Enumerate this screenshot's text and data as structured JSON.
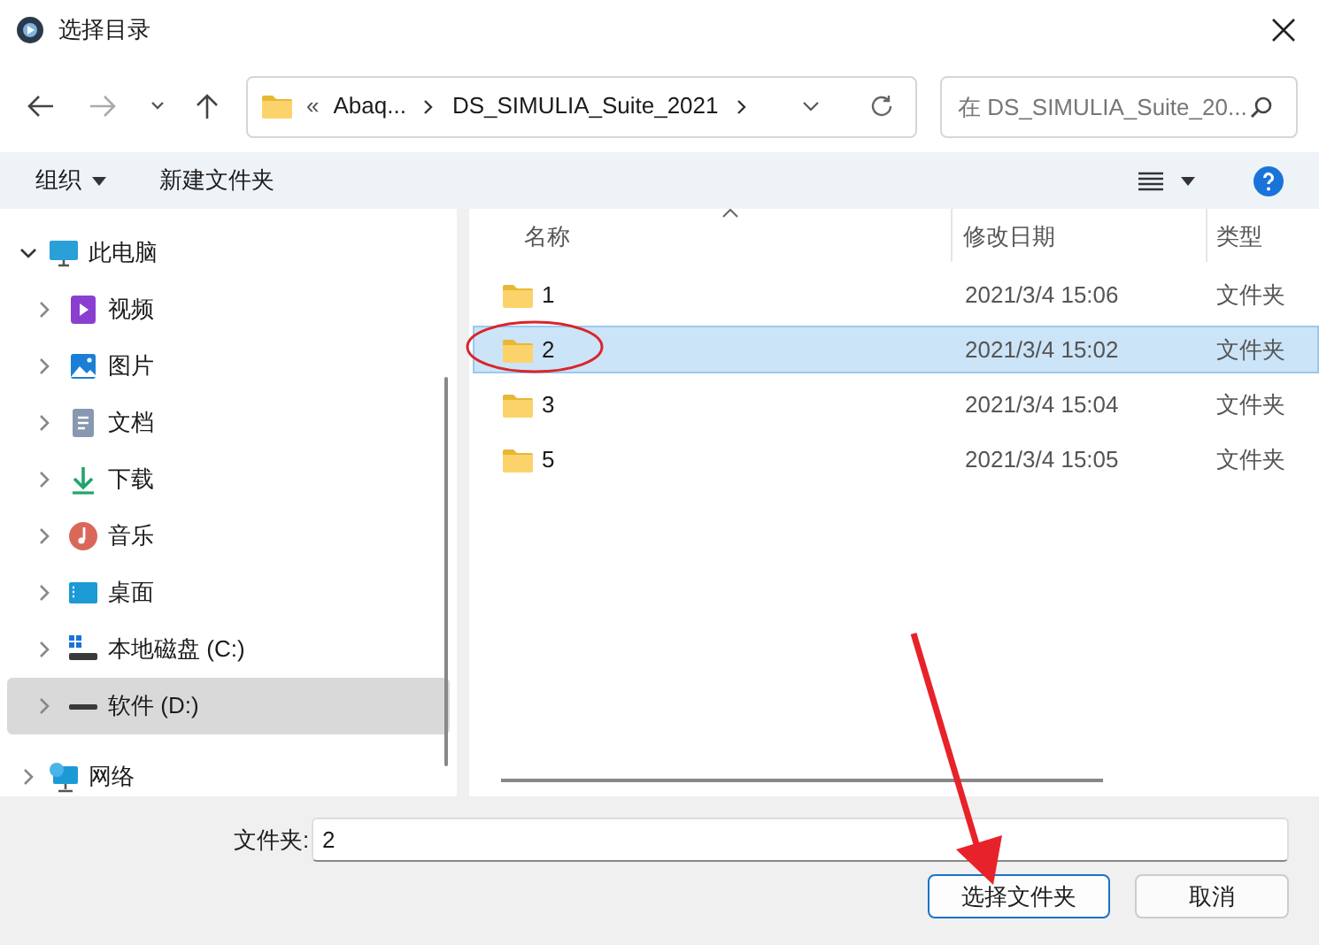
{
  "window": {
    "title": "选择目录"
  },
  "nav": {
    "overflow": "«",
    "address": [
      "Abaq...",
      "DS_SIMULIA_Suite_2021"
    ],
    "search": {
      "placeholder": "在 DS_SIMULIA_Suite_20..."
    }
  },
  "toolbar": {
    "organize": "组织",
    "new_folder": "新建文件夹"
  },
  "sidebar": {
    "items": [
      {
        "label": "此电脑",
        "kind": "pc",
        "expanded": true,
        "selected": false,
        "children": [
          {
            "label": "视频",
            "kind": "video",
            "expanded": false,
            "selected": false
          },
          {
            "label": "图片",
            "kind": "pictures",
            "expanded": false,
            "selected": false
          },
          {
            "label": "文档",
            "kind": "documents",
            "expanded": false,
            "selected": false
          },
          {
            "label": "下载",
            "kind": "downloads",
            "expanded": false,
            "selected": false
          },
          {
            "label": "音乐",
            "kind": "music",
            "expanded": false,
            "selected": false
          },
          {
            "label": "桌面",
            "kind": "desktop",
            "expanded": false,
            "selected": false
          },
          {
            "label": "本地磁盘 (C:)",
            "kind": "system-drive",
            "expanded": false,
            "selected": false
          },
          {
            "label": "软件 (D:)",
            "kind": "drive",
            "expanded": false,
            "selected": true
          }
        ]
      },
      {
        "label": "网络",
        "kind": "network",
        "expanded": false,
        "selected": false
      }
    ]
  },
  "table": {
    "columns": [
      "名称",
      "修改日期",
      "类型"
    ],
    "rows": [
      {
        "name": "1",
        "modified": "2021/3/4 15:06",
        "type": "文件夹",
        "selected": false
      },
      {
        "name": "2",
        "modified": "2021/3/4 15:02",
        "type": "文件夹",
        "selected": true
      },
      {
        "name": "3",
        "modified": "2021/3/4 15:04",
        "type": "文件夹",
        "selected": false
      },
      {
        "name": "5",
        "modified": "2021/3/4 15:05",
        "type": "文件夹",
        "selected": false
      }
    ]
  },
  "footer": {
    "folder_label": "文件夹:",
    "folder_value": "2",
    "buttons": [
      {
        "label": "选择文件夹",
        "kind": "primary"
      },
      {
        "label": "取消",
        "kind": "secondary"
      }
    ]
  }
}
